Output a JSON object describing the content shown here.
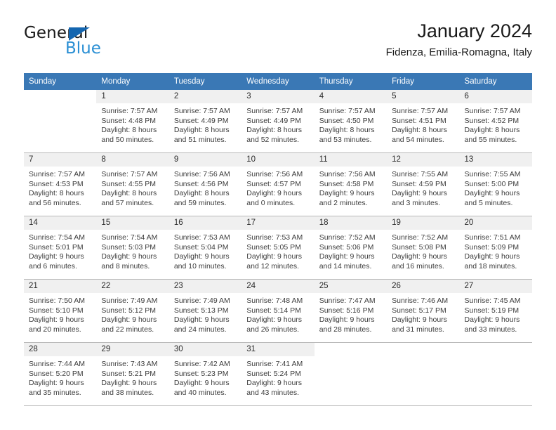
{
  "brand": {
    "name_top": "General",
    "name_bottom": "Blue",
    "accent_color": "#2a8fd4",
    "triangle_color": "#1466b0"
  },
  "header": {
    "title": "January 2024",
    "location": "Fidenza, Emilia-Romagna, Italy",
    "header_bg_color": "#3a78b5",
    "day_band_color": "#f0f0f0"
  },
  "weekdays": [
    "Sunday",
    "Monday",
    "Tuesday",
    "Wednesday",
    "Thursday",
    "Friday",
    "Saturday"
  ],
  "weeks": [
    [
      {
        "day": "",
        "lines": []
      },
      {
        "day": "1",
        "lines": [
          "Sunrise: 7:57 AM",
          "Sunset: 4:48 PM",
          "Daylight: 8 hours",
          "and 50 minutes."
        ]
      },
      {
        "day": "2",
        "lines": [
          "Sunrise: 7:57 AM",
          "Sunset: 4:49 PM",
          "Daylight: 8 hours",
          "and 51 minutes."
        ]
      },
      {
        "day": "3",
        "lines": [
          "Sunrise: 7:57 AM",
          "Sunset: 4:49 PM",
          "Daylight: 8 hours",
          "and 52 minutes."
        ]
      },
      {
        "day": "4",
        "lines": [
          "Sunrise: 7:57 AM",
          "Sunset: 4:50 PM",
          "Daylight: 8 hours",
          "and 53 minutes."
        ]
      },
      {
        "day": "5",
        "lines": [
          "Sunrise: 7:57 AM",
          "Sunset: 4:51 PM",
          "Daylight: 8 hours",
          "and 54 minutes."
        ]
      },
      {
        "day": "6",
        "lines": [
          "Sunrise: 7:57 AM",
          "Sunset: 4:52 PM",
          "Daylight: 8 hours",
          "and 55 minutes."
        ]
      }
    ],
    [
      {
        "day": "7",
        "lines": [
          "Sunrise: 7:57 AM",
          "Sunset: 4:53 PM",
          "Daylight: 8 hours",
          "and 56 minutes."
        ]
      },
      {
        "day": "8",
        "lines": [
          "Sunrise: 7:57 AM",
          "Sunset: 4:55 PM",
          "Daylight: 8 hours",
          "and 57 minutes."
        ]
      },
      {
        "day": "9",
        "lines": [
          "Sunrise: 7:56 AM",
          "Sunset: 4:56 PM",
          "Daylight: 8 hours",
          "and 59 minutes."
        ]
      },
      {
        "day": "10",
        "lines": [
          "Sunrise: 7:56 AM",
          "Sunset: 4:57 PM",
          "Daylight: 9 hours",
          "and 0 minutes."
        ]
      },
      {
        "day": "11",
        "lines": [
          "Sunrise: 7:56 AM",
          "Sunset: 4:58 PM",
          "Daylight: 9 hours",
          "and 2 minutes."
        ]
      },
      {
        "day": "12",
        "lines": [
          "Sunrise: 7:55 AM",
          "Sunset: 4:59 PM",
          "Daylight: 9 hours",
          "and 3 minutes."
        ]
      },
      {
        "day": "13",
        "lines": [
          "Sunrise: 7:55 AM",
          "Sunset: 5:00 PM",
          "Daylight: 9 hours",
          "and 5 minutes."
        ]
      }
    ],
    [
      {
        "day": "14",
        "lines": [
          "Sunrise: 7:54 AM",
          "Sunset: 5:01 PM",
          "Daylight: 9 hours",
          "and 6 minutes."
        ]
      },
      {
        "day": "15",
        "lines": [
          "Sunrise: 7:54 AM",
          "Sunset: 5:03 PM",
          "Daylight: 9 hours",
          "and 8 minutes."
        ]
      },
      {
        "day": "16",
        "lines": [
          "Sunrise: 7:53 AM",
          "Sunset: 5:04 PM",
          "Daylight: 9 hours",
          "and 10 minutes."
        ]
      },
      {
        "day": "17",
        "lines": [
          "Sunrise: 7:53 AM",
          "Sunset: 5:05 PM",
          "Daylight: 9 hours",
          "and 12 minutes."
        ]
      },
      {
        "day": "18",
        "lines": [
          "Sunrise: 7:52 AM",
          "Sunset: 5:06 PM",
          "Daylight: 9 hours",
          "and 14 minutes."
        ]
      },
      {
        "day": "19",
        "lines": [
          "Sunrise: 7:52 AM",
          "Sunset: 5:08 PM",
          "Daylight: 9 hours",
          "and 16 minutes."
        ]
      },
      {
        "day": "20",
        "lines": [
          "Sunrise: 7:51 AM",
          "Sunset: 5:09 PM",
          "Daylight: 9 hours",
          "and 18 minutes."
        ]
      }
    ],
    [
      {
        "day": "21",
        "lines": [
          "Sunrise: 7:50 AM",
          "Sunset: 5:10 PM",
          "Daylight: 9 hours",
          "and 20 minutes."
        ]
      },
      {
        "day": "22",
        "lines": [
          "Sunrise: 7:49 AM",
          "Sunset: 5:12 PM",
          "Daylight: 9 hours",
          "and 22 minutes."
        ]
      },
      {
        "day": "23",
        "lines": [
          "Sunrise: 7:49 AM",
          "Sunset: 5:13 PM",
          "Daylight: 9 hours",
          "and 24 minutes."
        ]
      },
      {
        "day": "24",
        "lines": [
          "Sunrise: 7:48 AM",
          "Sunset: 5:14 PM",
          "Daylight: 9 hours",
          "and 26 minutes."
        ]
      },
      {
        "day": "25",
        "lines": [
          "Sunrise: 7:47 AM",
          "Sunset: 5:16 PM",
          "Daylight: 9 hours",
          "and 28 minutes."
        ]
      },
      {
        "day": "26",
        "lines": [
          "Sunrise: 7:46 AM",
          "Sunset: 5:17 PM",
          "Daylight: 9 hours",
          "and 31 minutes."
        ]
      },
      {
        "day": "27",
        "lines": [
          "Sunrise: 7:45 AM",
          "Sunset: 5:19 PM",
          "Daylight: 9 hours",
          "and 33 minutes."
        ]
      }
    ],
    [
      {
        "day": "28",
        "lines": [
          "Sunrise: 7:44 AM",
          "Sunset: 5:20 PM",
          "Daylight: 9 hours",
          "and 35 minutes."
        ]
      },
      {
        "day": "29",
        "lines": [
          "Sunrise: 7:43 AM",
          "Sunset: 5:21 PM",
          "Daylight: 9 hours",
          "and 38 minutes."
        ]
      },
      {
        "day": "30",
        "lines": [
          "Sunrise: 7:42 AM",
          "Sunset: 5:23 PM",
          "Daylight: 9 hours",
          "and 40 minutes."
        ]
      },
      {
        "day": "31",
        "lines": [
          "Sunrise: 7:41 AM",
          "Sunset: 5:24 PM",
          "Daylight: 9 hours",
          "and 43 minutes."
        ]
      },
      {
        "day": "",
        "lines": []
      },
      {
        "day": "",
        "lines": []
      },
      {
        "day": "",
        "lines": []
      }
    ]
  ]
}
